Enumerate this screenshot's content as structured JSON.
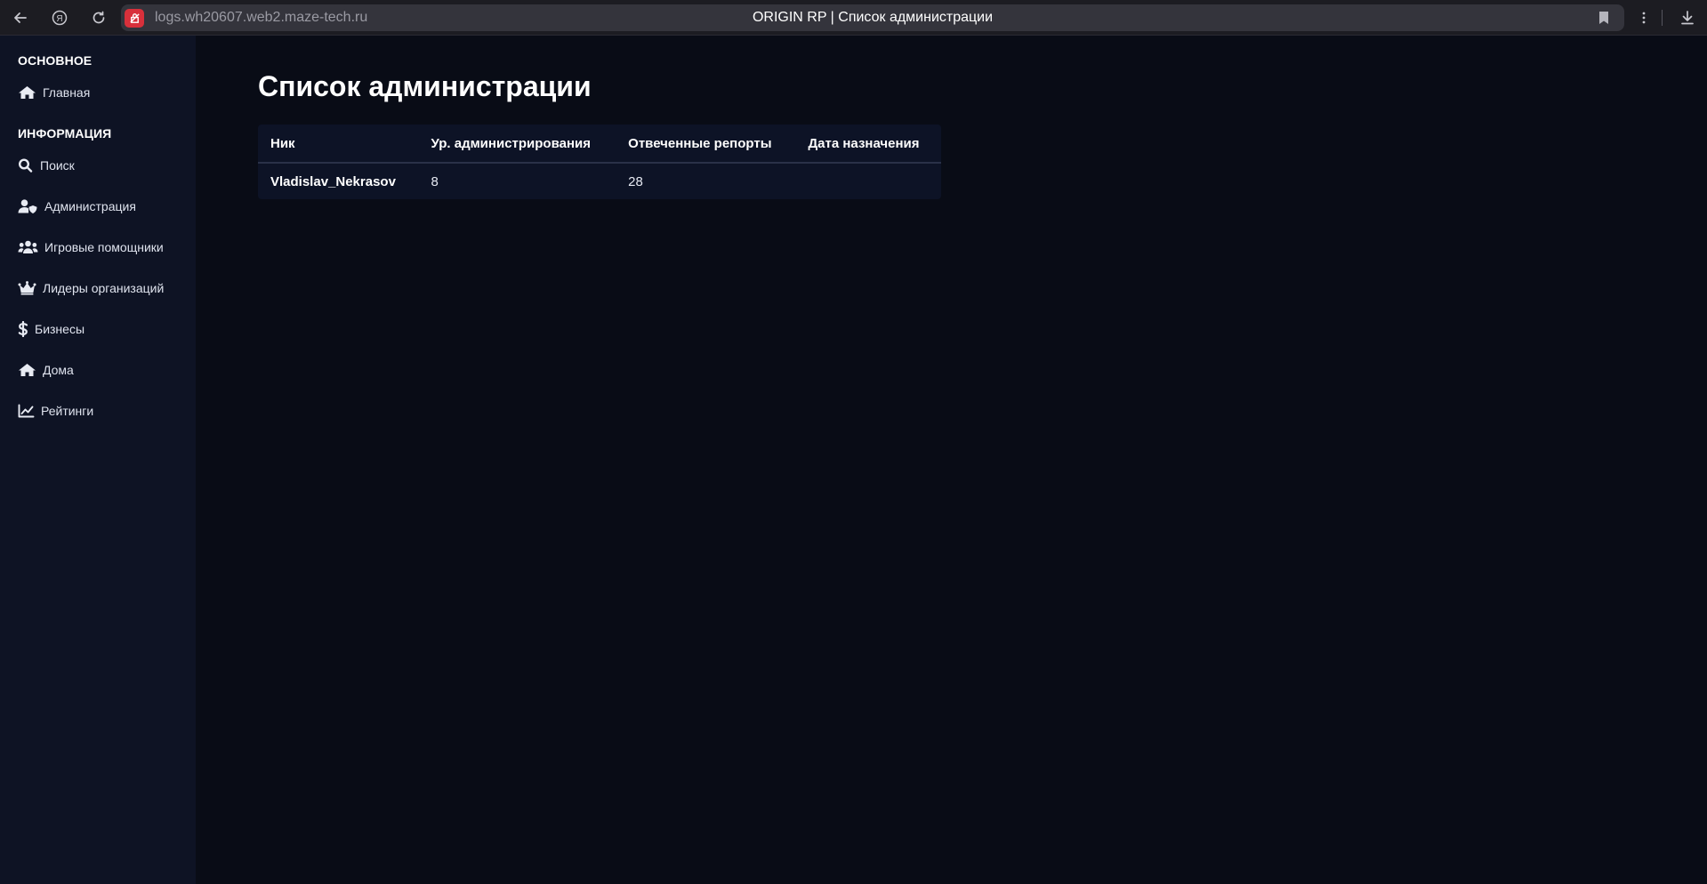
{
  "browser": {
    "url": "logs.wh20607.web2.maze-tech.ru",
    "tab_title": "ORIGIN RP | Список администрации",
    "icons": [
      "back-arrow-icon",
      "yandex-icon",
      "reload-icon",
      "site-icon",
      "bookmark-icon",
      "more-icon",
      "download-icon"
    ]
  },
  "sidebar": {
    "sections": [
      {
        "heading": "ОСНОВНОЕ",
        "items": [
          {
            "label": "Главная",
            "icon": "home-icon"
          }
        ]
      },
      {
        "heading": "ИНФОРМАЦИЯ",
        "items": [
          {
            "label": "Поиск",
            "icon": "search-icon"
          },
          {
            "label": "Администрация",
            "icon": "user-shield-icon"
          },
          {
            "label": "Игровые помощники",
            "icon": "users-icon"
          },
          {
            "label": "Лидеры организаций",
            "icon": "crown-icon"
          },
          {
            "label": "Бизнесы",
            "icon": "dollar-icon"
          },
          {
            "label": "Дома",
            "icon": "home-icon"
          },
          {
            "label": "Рейтинги",
            "icon": "chart-line-icon"
          }
        ]
      }
    ]
  },
  "main": {
    "title": "Список администрации",
    "table": {
      "columns": [
        "Ник",
        "Ур. администрирования",
        "Отвеченные репорты",
        "Дата назначения"
      ],
      "rows": [
        [
          "Vladislav_Nekrasov",
          "8",
          "28",
          ""
        ]
      ]
    }
  }
}
